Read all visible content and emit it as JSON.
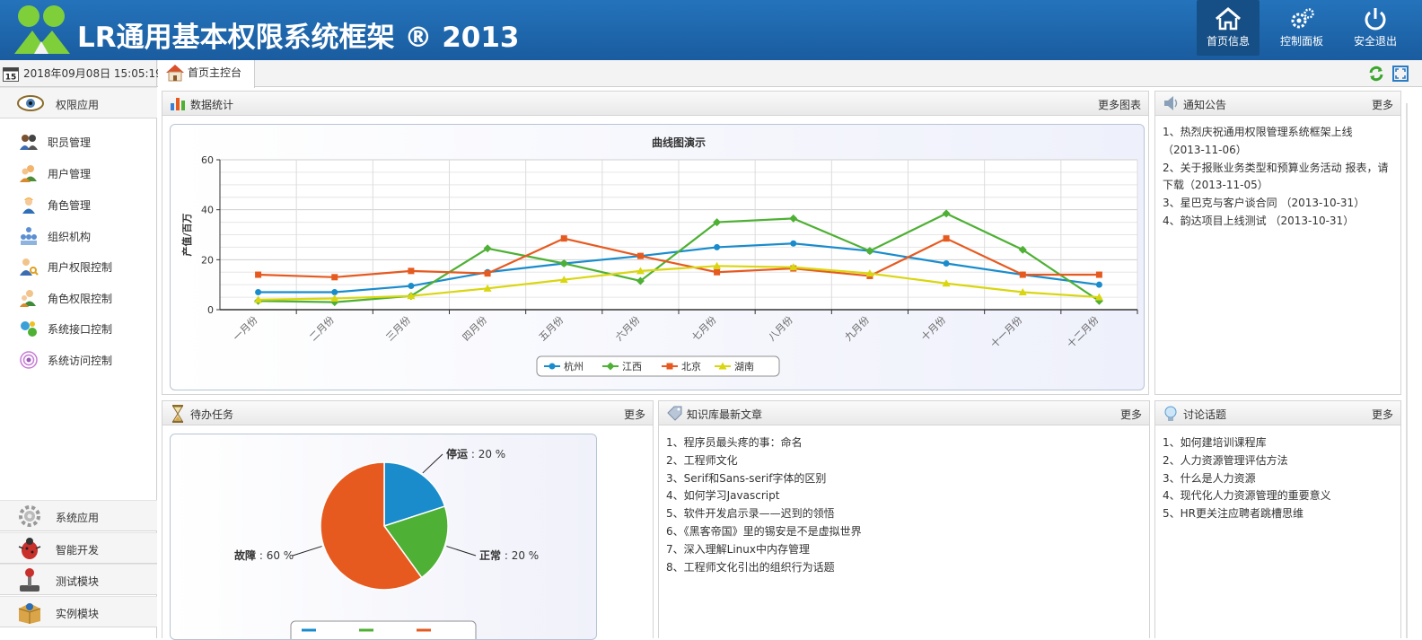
{
  "header": {
    "title": "LR通用基本权限系统框架 ® 2013",
    "buttons": [
      {
        "label": "首页信息",
        "icon": "home-icon"
      },
      {
        "label": "控制面板",
        "icon": "gears-icon"
      },
      {
        "label": "安全退出",
        "icon": "power-icon"
      }
    ],
    "brand_color": "#1e5fa3"
  },
  "topbar": {
    "datetime": "2018年09月08日 15:05:19",
    "calendar_day": "15",
    "tab_label": "首页主控台"
  },
  "sidebar": {
    "section_label": "权限应用",
    "items": [
      {
        "label": "职员管理",
        "icon": "staff-icon"
      },
      {
        "label": "用户管理",
        "icon": "users-icon"
      },
      {
        "label": "角色管理",
        "icon": "role-icon"
      },
      {
        "label": "组织机构",
        "icon": "organization-icon"
      },
      {
        "label": "用户权限控制",
        "icon": "user-permission-icon"
      },
      {
        "label": "角色权限控制",
        "icon": "role-permission-icon"
      },
      {
        "label": "系统接口控制",
        "icon": "interface-icon"
      },
      {
        "label": "系统访问控制",
        "icon": "access-icon"
      }
    ],
    "bottom_sections": [
      {
        "label": "系统应用",
        "icon": "gear-icon"
      },
      {
        "label": "智能开发",
        "icon": "bug-icon"
      },
      {
        "label": "测试模块",
        "icon": "joystick-icon"
      },
      {
        "label": "实例模块",
        "icon": "package-icon"
      }
    ]
  },
  "panels": {
    "stats": {
      "title": "数据统计",
      "more": "更多图表"
    },
    "notice": {
      "title": "通知公告",
      "more": "更多",
      "items": [
        "1、热烈庆祝通用权限管理系统框架上线 （2013-11-06）",
        "2、关于报账业务类型和预算业务活动 报表，请下载（2013-11-05）",
        "3、星巴克与客户谈合同 （2013-10-31）",
        "4、韵达项目上线测试 （2013-10-31）"
      ]
    },
    "todo": {
      "title": "待办任务",
      "more": "更多"
    },
    "knowledge": {
      "title": "知识库最新文章",
      "more": "更多",
      "items": [
        "1、程序员最头疼的事：命名",
        "2、工程师文化",
        "3、Serif和Sans-serif字体的区别",
        "4、如何学习Javascript",
        "5、软件开发启示录——迟到的领悟",
        "6、《黑客帝国》里的锡安是不是虚拟世界",
        "7、深入理解Linux中内存管理",
        "8、工程师文化引出的组织行为话题"
      ]
    },
    "discussion": {
      "title": "讨论话题",
      "more": "更多",
      "items": [
        "1、如何建培训课程库",
        "2、人力资源管理评估方法",
        "3、什么是人力资源",
        "4、现代化人力资源管理的重要意义",
        "5、HR更关注应聘者跳槽思维"
      ]
    }
  },
  "chart_data": [
    {
      "type": "line",
      "title": "曲线图演示",
      "ylabel": "产值/百万",
      "xlabel": "",
      "ylim": [
        0,
        60
      ],
      "yticks": [
        "0",
        "20",
        "40",
        "60"
      ],
      "grid": true,
      "legend": "bottom-center",
      "categories": [
        "一月份",
        "二月份",
        "三月份",
        "四月份",
        "五月份",
        "六月份",
        "七月份",
        "八月份",
        "九月份",
        "十月份",
        "十一月份",
        "十二月份"
      ],
      "series": [
        {
          "name": "杭州",
          "color": "#1a8ccc",
          "marker": "circle",
          "values": [
            7,
            7,
            9.5,
            15,
            18.5,
            21.5,
            25,
            26.5,
            23.5,
            18.5,
            14,
            10
          ]
        },
        {
          "name": "江西",
          "color": "#4eb034",
          "marker": "diamond",
          "values": [
            3.5,
            3,
            5.5,
            24.5,
            18.5,
            11.5,
            35,
            36.5,
            23.5,
            38.5,
            24,
            3.5
          ]
        },
        {
          "name": "北京",
          "color": "#e65a20",
          "marker": "square",
          "values": [
            14,
            13,
            15.5,
            14.5,
            28.5,
            21.5,
            15,
            16.5,
            13.5,
            28.5,
            14,
            14
          ]
        },
        {
          "name": "湖南",
          "color": "#d9d611",
          "marker": "triangle",
          "values": [
            4,
            4.5,
            5.5,
            8.5,
            12,
            15.5,
            17.5,
            17,
            14.5,
            10.5,
            7,
            5
          ]
        }
      ]
    },
    {
      "type": "pie",
      "slices": [
        {
          "label": "停运",
          "value": 20,
          "color": "#1a8ccc",
          "text": " : 20 %"
        },
        {
          "label": "正常",
          "value": 20,
          "color": "#4eb034",
          "text": " : 20 %"
        },
        {
          "label": "故障",
          "value": 60,
          "color": "#e65a20",
          "text": " : 60 %"
        }
      ]
    }
  ]
}
